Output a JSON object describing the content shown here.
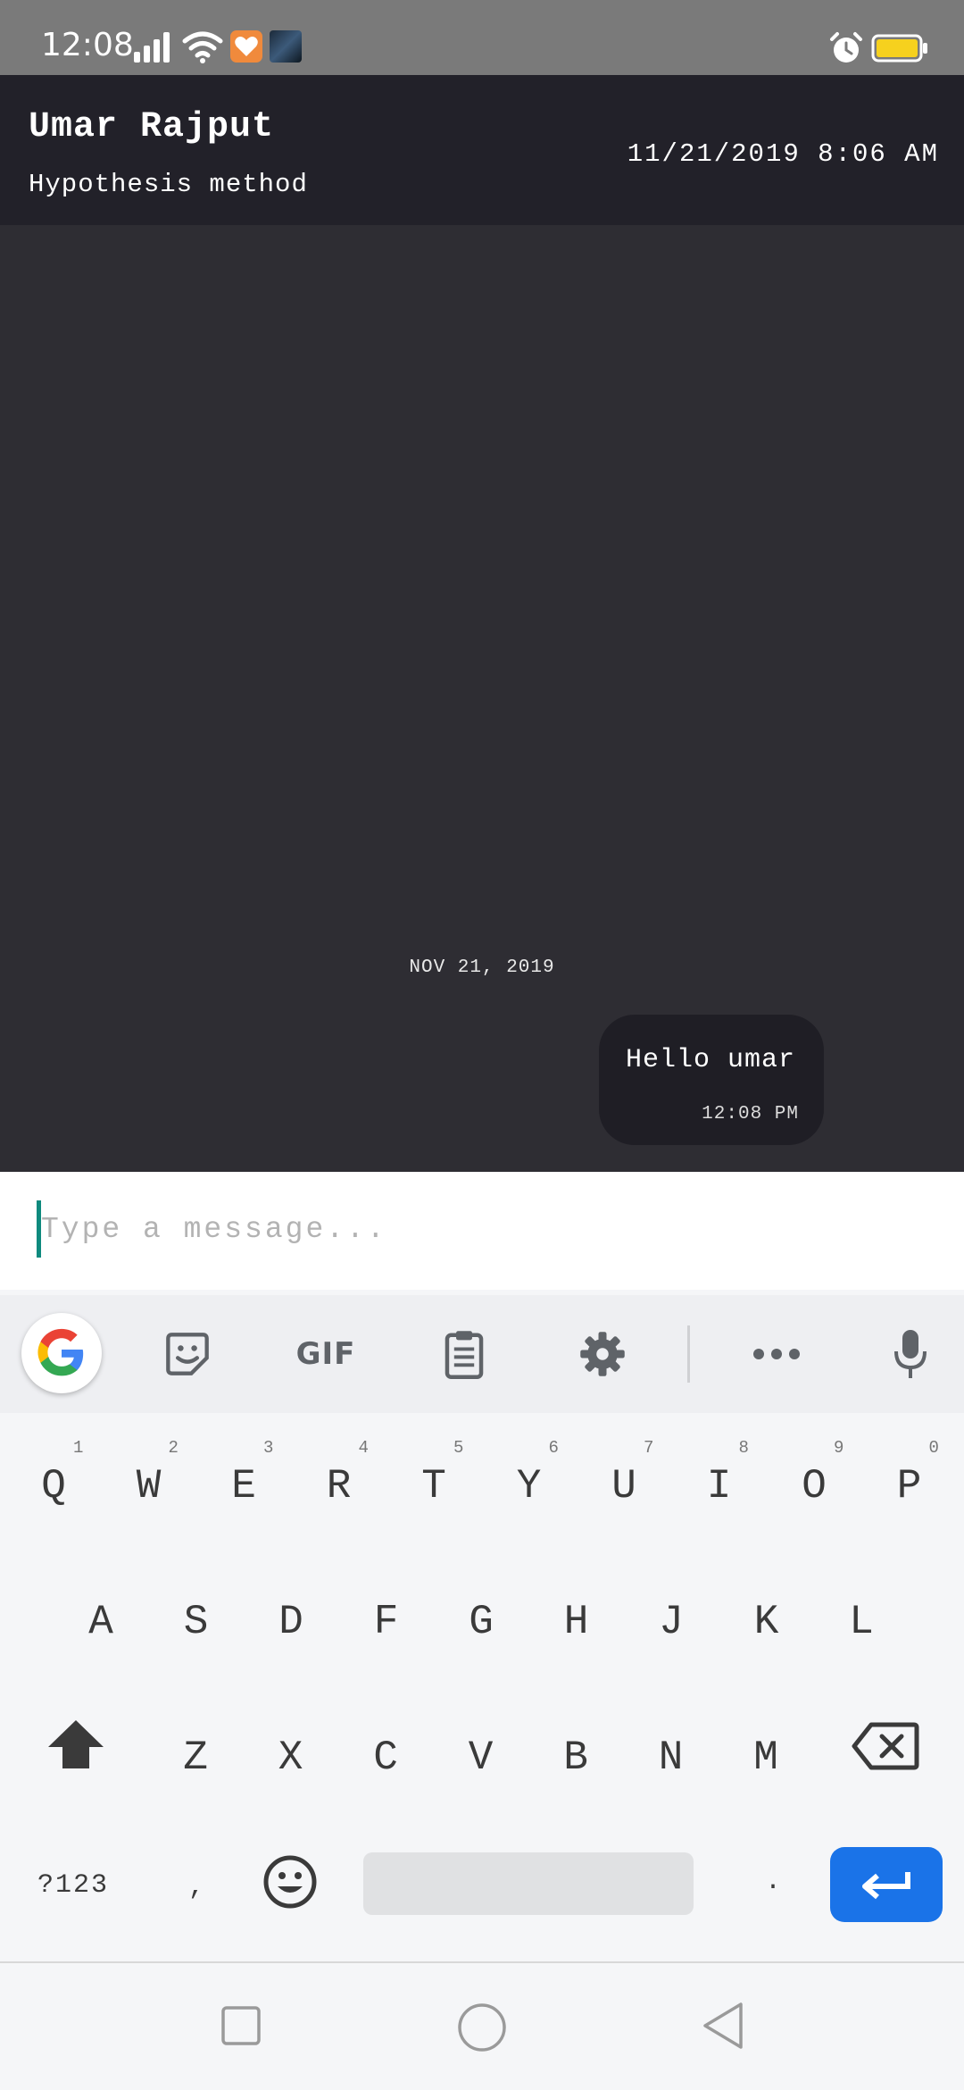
{
  "status_bar": {
    "time": "12:08",
    "battery_color": "#f6d11e"
  },
  "header": {
    "contact_name": "Umar Rajput",
    "subtitle": "Hypothesis method",
    "datetime": "11/21/2019 8:06 AM"
  },
  "chat": {
    "date_divider": "NOV 21, 2019",
    "messages": [
      {
        "text": "Hello umar",
        "time": "12:08 PM",
        "direction": "outgoing"
      }
    ]
  },
  "composer": {
    "placeholder": "Type a message..."
  },
  "keyboard": {
    "toolbar": {
      "gif_label": "GIF",
      "icons": [
        "google-icon",
        "sticker-icon",
        "gif-icon",
        "clipboard-icon",
        "settings-gear-icon",
        "more-dots-icon",
        "microphone-icon"
      ]
    },
    "row1": [
      "Q",
      "W",
      "E",
      "R",
      "T",
      "Y",
      "U",
      "I",
      "O",
      "P"
    ],
    "row1_hints": [
      "1",
      "2",
      "3",
      "4",
      "5",
      "6",
      "7",
      "8",
      "9",
      "0"
    ],
    "row2": [
      "A",
      "S",
      "D",
      "F",
      "G",
      "H",
      "J",
      "K",
      "L"
    ],
    "row3": [
      "Z",
      "X",
      "C",
      "V",
      "B",
      "N",
      "M"
    ],
    "symbols_label": "?123",
    "comma": ",",
    "period": ".",
    "enter_color": "#1a73e8"
  },
  "colors": {
    "chat_background": "#2e2d33",
    "header_background": "#222129",
    "bubble_background": "#1f1e25",
    "cursor_accent": "#0f8a7e"
  }
}
